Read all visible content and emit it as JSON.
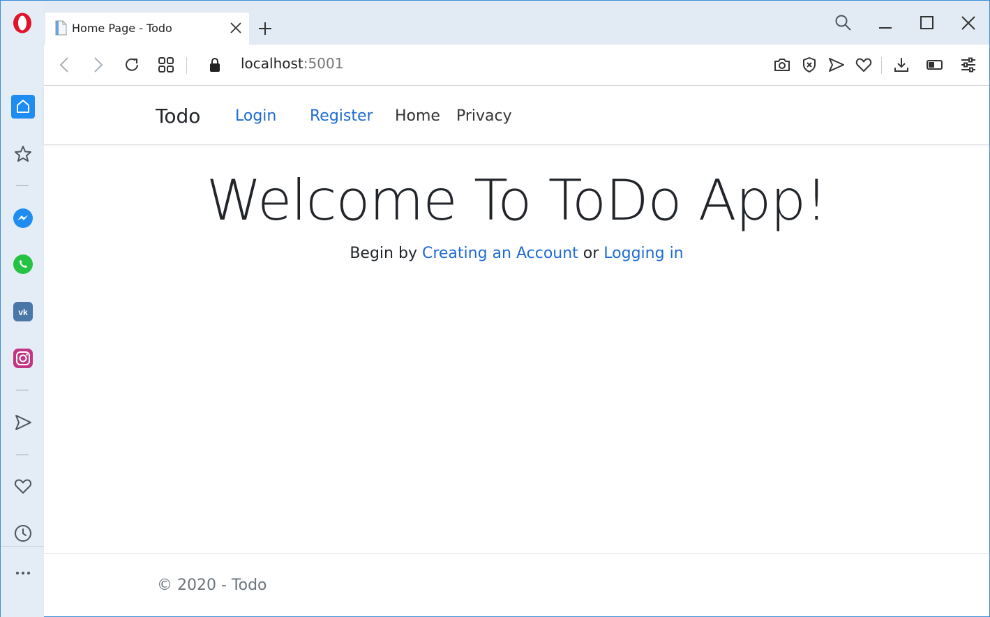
{
  "browser": {
    "tab_title": "Home Page - Todo",
    "url_host": "localhost",
    "url_port": ":5001"
  },
  "icons": [
    "opera-logo-icon",
    "home-icon",
    "star-icon",
    "messenger-icon",
    "whatsapp-icon",
    "vk-icon",
    "instagram-icon",
    "send-icon",
    "heart-icon",
    "clock-icon",
    "more-icon",
    "search-icon",
    "minimize-icon",
    "maximize-icon",
    "close-icon",
    "back-icon",
    "forward-icon",
    "reload-icon",
    "speed-dial-icon",
    "lock-icon",
    "camera-icon",
    "shield-icon",
    "download-icon",
    "battery-icon",
    "settings-icon"
  ],
  "nav": {
    "brand": "Todo",
    "login": "Login",
    "register": "Register",
    "home": "Home",
    "privacy": "Privacy"
  },
  "hero": {
    "title": "Welcome To ToDo App!",
    "begin_text": "Begin by ",
    "create_link": "Creating an Account",
    "or_text": " or ",
    "login_link": "Logging in"
  },
  "footer": {
    "text": "© 2020 - Todo"
  },
  "colors": {
    "link": "#1e6ad6",
    "sidebar_accent": "#1e8cf0",
    "opera_red": "#e0142b"
  }
}
